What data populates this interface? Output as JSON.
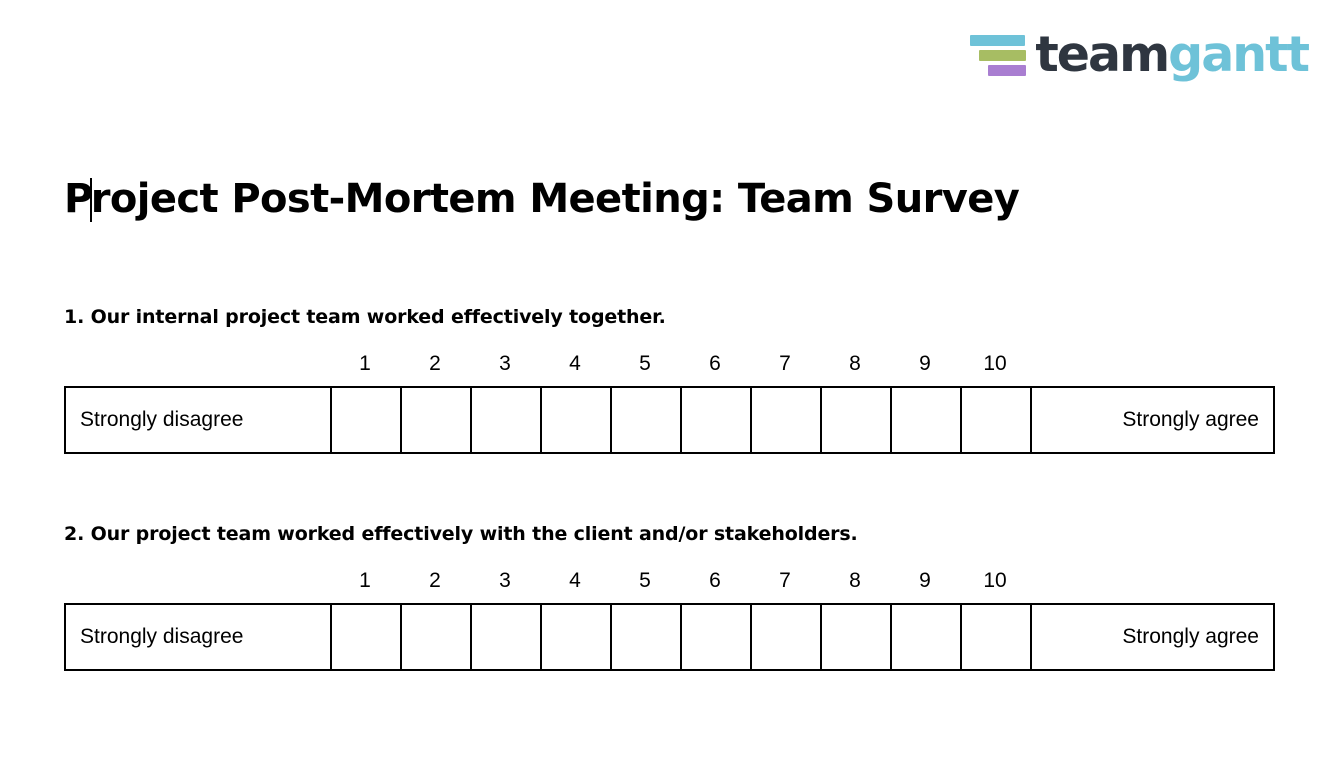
{
  "brand": {
    "name_dark": "team",
    "name_light": "gantt",
    "color_dark": "#2f3640",
    "color_light": "#6ec2d8",
    "bars": [
      {
        "name": "logo-bar-cyan",
        "color": "#6ec2d8"
      },
      {
        "name": "logo-bar-green",
        "color": "#a7bd63"
      },
      {
        "name": "logo-bar-purple",
        "color": "#a97ed1"
      }
    ]
  },
  "document": {
    "title": "Project Post-Mortem Meeting: Team Survey"
  },
  "scale": {
    "numbers": [
      "1",
      "2",
      "3",
      "4",
      "5",
      "6",
      "7",
      "8",
      "9",
      "10"
    ],
    "anchor_low": "Strongly disagree",
    "anchor_high": "Strongly agree"
  },
  "questions": [
    {
      "text": "1. Our internal project team worked effectively together."
    },
    {
      "text": "2. Our project team worked effectively with the client and/or stakeholders."
    }
  ]
}
